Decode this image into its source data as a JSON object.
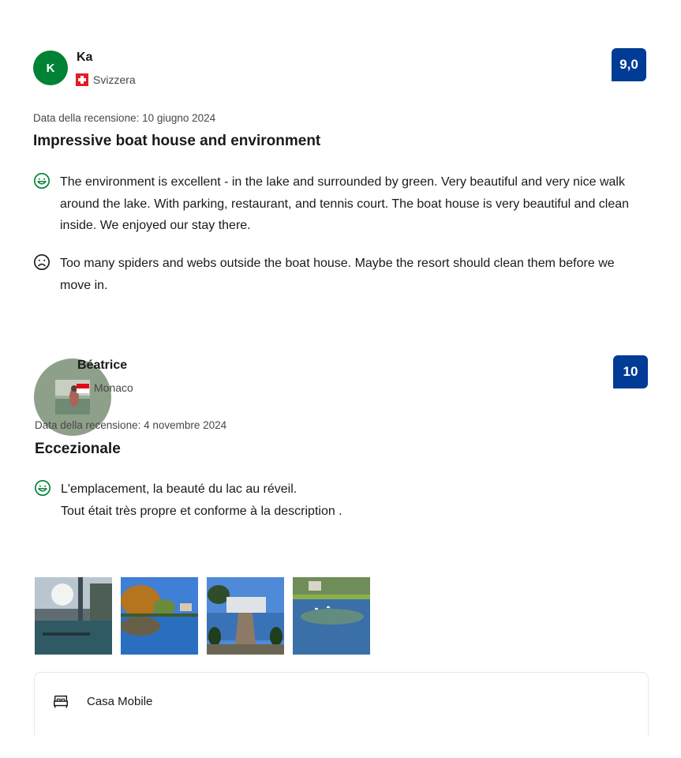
{
  "reviews": [
    {
      "avatar_letter": "K",
      "name": "Ka",
      "country": "Svizzera",
      "score": "9,0",
      "date": "Data della recensione: 10 giugno 2024",
      "title": "Impressive boat house and environment",
      "positive": "The environment is excellent - in the lake and surrounded by green. Very beautiful and very nice walk around the lake. With parking, restaurant, and tennis court. The boat house is very beautiful and clean inside. We enjoyed our stay there.",
      "negative": "Too many spiders and webs outside the boat house. Maybe the resort should clean them before we move in."
    },
    {
      "name": "Béatrice",
      "country": "Monaco",
      "score": "10",
      "date": "Data della recensione: 4 novembre 2024",
      "title": "Eccezionale",
      "positive_line1": "L'emplacement, la beauté du lac au réveil.",
      "positive_line2": "Tout était très propre et conforme à la description ."
    }
  ],
  "room": {
    "label": "Casa Mobile",
    "icon": "bed-icon"
  },
  "colors": {
    "score_bg": "#003b95",
    "avatar_bg": "#008234",
    "positive": "#008234",
    "negative": "#1a1a1a"
  }
}
